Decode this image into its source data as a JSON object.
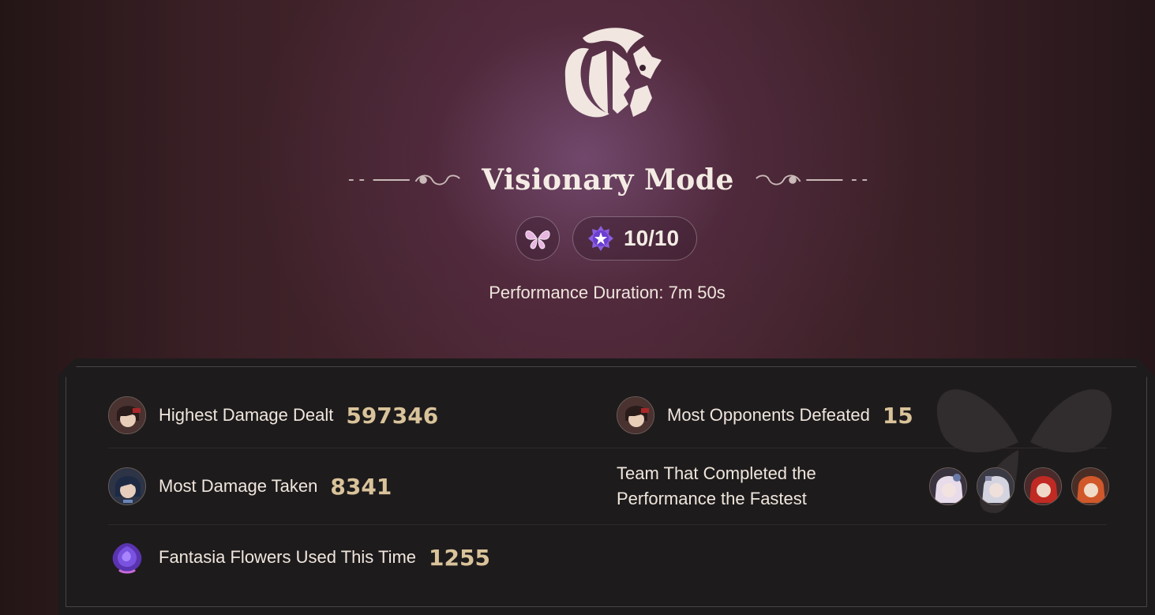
{
  "header": {
    "title": "Visionary Mode",
    "emblem_icon": "theater-mask-emblem-icon",
    "badge_icon": "butterfly-icon",
    "progress_icon": "star-medal-icon",
    "progress_text": "10/10",
    "duration_text": "Performance Duration: 7m 50s"
  },
  "stats": {
    "highest_damage": {
      "label": "Highest Damage Dealt",
      "value": "597346",
      "avatar": "character-avatar"
    },
    "most_defeated": {
      "label": "Most Opponents Defeated",
      "value": "15",
      "avatar": "character-avatar"
    },
    "damage_taken": {
      "label": "Most Damage Taken",
      "value": "8341",
      "avatar": "character-avatar"
    },
    "fastest_team": {
      "label": "Team That Completed the Performance the Fastest",
      "avatars": [
        "character-avatar",
        "character-avatar",
        "character-avatar",
        "character-avatar"
      ]
    },
    "flowers": {
      "label": "Fantasia Flowers Used This Time",
      "value": "1255",
      "icon": "fantasia-flower-icon"
    }
  },
  "colors": {
    "accent_value": "#d9c39a",
    "panel_bg": "#1e1b1c",
    "text": "#efe6dd"
  }
}
